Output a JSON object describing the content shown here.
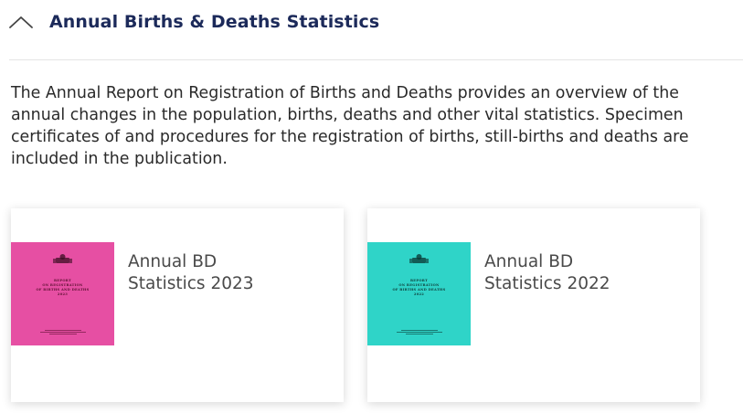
{
  "section": {
    "title": "Annual Births & Deaths Statistics",
    "expanded": true,
    "icon": "chevron-up-icon"
  },
  "description": "The Annual Report on Registration of Births and Deaths provides an overview of the annual changes in the population, births, deaths and other vital statistics. Specimen certificates of and procedures for the registration of births, still-births and deaths are included in the publication.",
  "colors": {
    "title": "#1c2a5a",
    "cover_2023": "#e64fa3",
    "cover_2022": "#2fd4c8"
  },
  "publications": [
    {
      "title_line1": "Annual BD",
      "title_line2": "Statistics 2023",
      "cover": {
        "line1": "REPORT",
        "line2": "ON REGISTRATION",
        "line3": "OF BIRTHS AND DEATHS",
        "year": "2023"
      }
    },
    {
      "title_line1": "Annual BD",
      "title_line2": "Statistics 2022",
      "cover": {
        "line1": "REPORT",
        "line2": "ON REGISTRATION",
        "line3": "OF BIRTHS AND DEATHS",
        "year": "2022"
      }
    }
  ]
}
